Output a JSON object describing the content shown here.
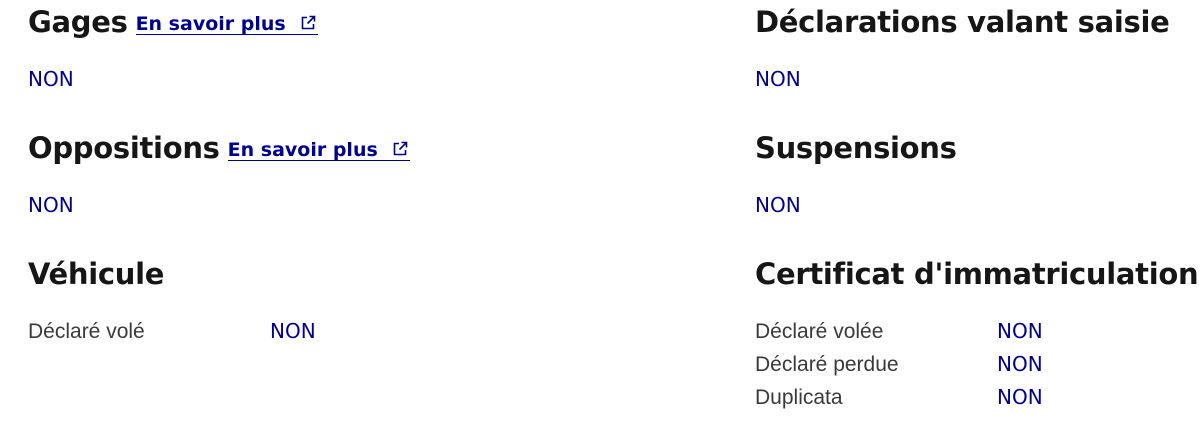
{
  "left": {
    "gages": {
      "title": "Gages",
      "link_label": "En savoir plus",
      "value": "NON"
    },
    "oppositions": {
      "title": "Oppositions",
      "link_label": "En savoir plus",
      "value": "NON"
    },
    "vehicule": {
      "title": "Véhicule",
      "rows": [
        {
          "label": "Déclaré volé",
          "value": "NON"
        }
      ]
    }
  },
  "right": {
    "declarations": {
      "title": "Déclarations valant saisie",
      "value": "NON"
    },
    "suspensions": {
      "title": "Suspensions",
      "value": "NON"
    },
    "certificat": {
      "title": "Certificat d'immatriculation",
      "rows": [
        {
          "label": "Déclaré volée",
          "value": "NON"
        },
        {
          "label": "Déclaré perdue",
          "value": "NON"
        },
        {
          "label": "Duplicata",
          "value": "NON"
        }
      ]
    }
  },
  "colors": {
    "accent": "#000091",
    "title": "#161616",
    "label": "#3a3a3a"
  },
  "icons": {
    "external_link": "external-link-icon"
  }
}
